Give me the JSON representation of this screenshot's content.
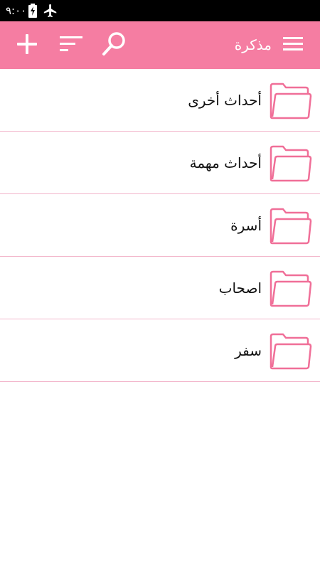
{
  "status_bar": {
    "time": "٩:٠٠",
    "icons": [
      "battery-charging-icon",
      "airplane-mode-icon"
    ]
  },
  "toolbar": {
    "title": "مذكرة",
    "buttons": [
      "add-icon",
      "sort-icon",
      "search-icon",
      "menu-icon"
    ]
  },
  "colors": {
    "accent": "#f57da2",
    "divider": "#f3b6cb",
    "folder_stroke": "#f06f98"
  },
  "folders": [
    {
      "label": "أحداث أخرى",
      "icon": "folder-icon"
    },
    {
      "label": "أحداث مهمة",
      "icon": "folder-icon"
    },
    {
      "label": "أسرة",
      "icon": "folder-icon"
    },
    {
      "label": "اصحاب",
      "icon": "folder-icon"
    },
    {
      "label": "سفر",
      "icon": "folder-icon"
    }
  ]
}
